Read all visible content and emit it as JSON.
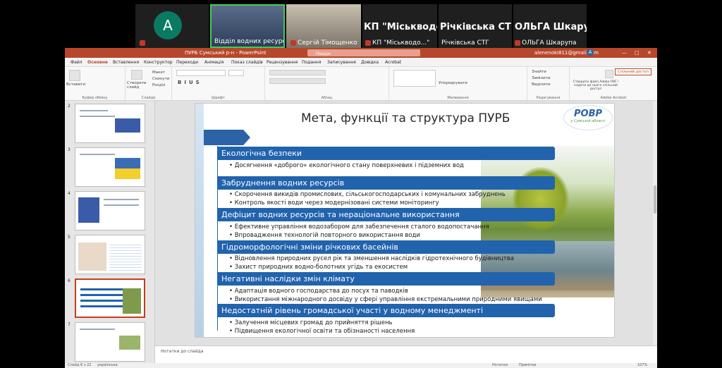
{
  "participants": [
    {
      "name": "A",
      "initial": "A"
    },
    {
      "name": "Відділ водних ресурсів Р..."
    },
    {
      "name": "Сергій Тімощенко"
    },
    {
      "name": "КП \"Міськводо...\"",
      "label": "КП \"Міськводоканал\" ..."
    },
    {
      "name": "Річківська СТГ",
      "label": "Річківська СТГ"
    },
    {
      "name": "ОЛЬГА Шкарупа",
      "label": "ОЛЬГА Шкарупа"
    }
  ],
  "app": {
    "title": "ПУРБ Сумський р-н - PowerPoint",
    "search_placeholder": "Пошук",
    "user": "alenenoki811@gmail.com",
    "avatar_initial": "A"
  },
  "menu": [
    "Файл",
    "Основне",
    "Вставлення",
    "Конструктор",
    "Переходи",
    "Анімація",
    "Показ слайдів",
    "Рецензування",
    "Подання",
    "Записування",
    "Довідка",
    "Acrobat"
  ],
  "ribbon": {
    "groups": [
      "Буфер обміну",
      "Слайди",
      "Шрифт",
      "Абзац",
      "Малювання",
      "Редагування",
      "Adobe Acrobat"
    ],
    "paste": "Вставити",
    "new_slide": "Створити слайд",
    "layout": "Макет",
    "reset": "Скинути",
    "section": "Розділ",
    "arrange": "Упорядкувати",
    "find": "Знайти",
    "replace": "Замінити",
    "select": "Виділити",
    "acrobat": "Створити файл Adobe PDF і надати до нього спільний доступ",
    "share": "Спільний доступ"
  },
  "thumbs": [
    "2",
    "3",
    "4",
    "5",
    "6",
    "7"
  ],
  "slide": {
    "title": "Мета, функції та структура ПУРБ",
    "logo_text": "РОВР",
    "logo_sub": "у Сумській області",
    "sections": [
      {
        "heading": "Екологічна безпеки",
        "bullets": [
          "Досягнення «доброго» екологічного стану поверхневих і підземних вод"
        ]
      },
      {
        "heading": "Забруднення водних ресурсів",
        "bullets": [
          "Скорочення викидів промислових, сільськогосподарських і комунальних забруднень",
          "Контроль якості води через модернізовані системи моніторингу"
        ]
      },
      {
        "heading": "Дефіцит водних ресурсів та нераціональне використання",
        "bullets": [
          "Ефективне управління водозабором для забезпечення сталого водопостачання",
          "Впровадження технологій повторного використання води"
        ]
      },
      {
        "heading": "Гідроморфологічні зміни річкових басейнів",
        "bullets": [
          "Відновлення природних русел рік та зменшення наслідків гідротехнічного будівництва",
          "Захист природних водно-болотних угідь та екосистем"
        ]
      },
      {
        "heading": "Негативні наслідки змін клімату",
        "bullets": [
          "Адаптація водного господарства до посух та паводків",
          "Використання міжнародного досвіду у сфері управління екстремальними природними явищами"
        ]
      },
      {
        "heading": "Недостатній рівень громадської участі у водному менеджменті",
        "bullets": [
          "Залучення місцевих громад до прийняття рішень",
          "Підвищення екологічної освіти та обізнаності населення"
        ]
      }
    ]
  },
  "notes_placeholder": "Нотатки до слайда",
  "status": {
    "slide": "Слайд 6 з 22",
    "lang": "українська",
    "notes": "Нотатки",
    "comments": "Примітки",
    "zoom": "107%"
  }
}
